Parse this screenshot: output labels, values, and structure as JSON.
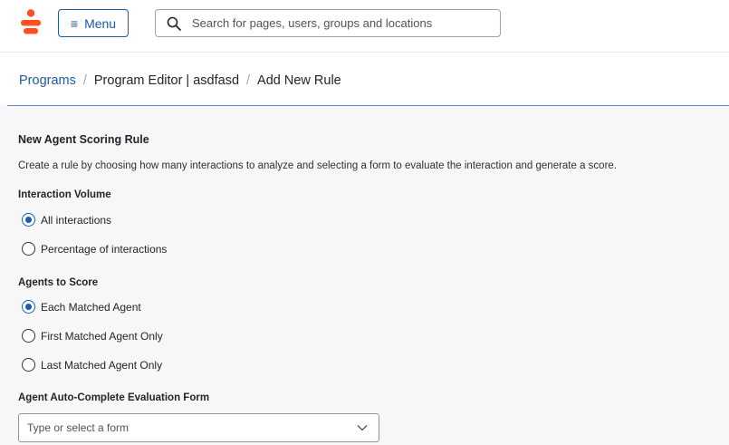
{
  "header": {
    "menu_label": "Menu",
    "search_placeholder": "Search for pages, users, groups and locations",
    "brand_color": "#ff4f1f",
    "accent_color": "#1f5ba7"
  },
  "breadcrumb": {
    "items": [
      {
        "label": "Programs",
        "link": true
      },
      {
        "label": "Program Editor | asdfasd",
        "link": false
      },
      {
        "label": "Add New Rule",
        "link": false
      }
    ],
    "separator": "/"
  },
  "form": {
    "title": "New Agent Scoring Rule",
    "description": "Create a rule by choosing how many interactions to analyze and selecting a form to evaluate the interaction and generate a score.",
    "interaction_volume": {
      "label": "Interaction Volume",
      "options": [
        {
          "label": "All interactions",
          "checked": true
        },
        {
          "label": "Percentage of interactions",
          "checked": false
        }
      ]
    },
    "agents_to_score": {
      "label": "Agents to Score",
      "options": [
        {
          "label": "Each Matched Agent",
          "checked": true
        },
        {
          "label": "First Matched Agent Only",
          "checked": false
        },
        {
          "label": "Last Matched Agent Only",
          "checked": false
        }
      ]
    },
    "evaluation_form": {
      "label": "Agent Auto-Complete Evaluation Form",
      "placeholder": "Type or select a form"
    }
  }
}
